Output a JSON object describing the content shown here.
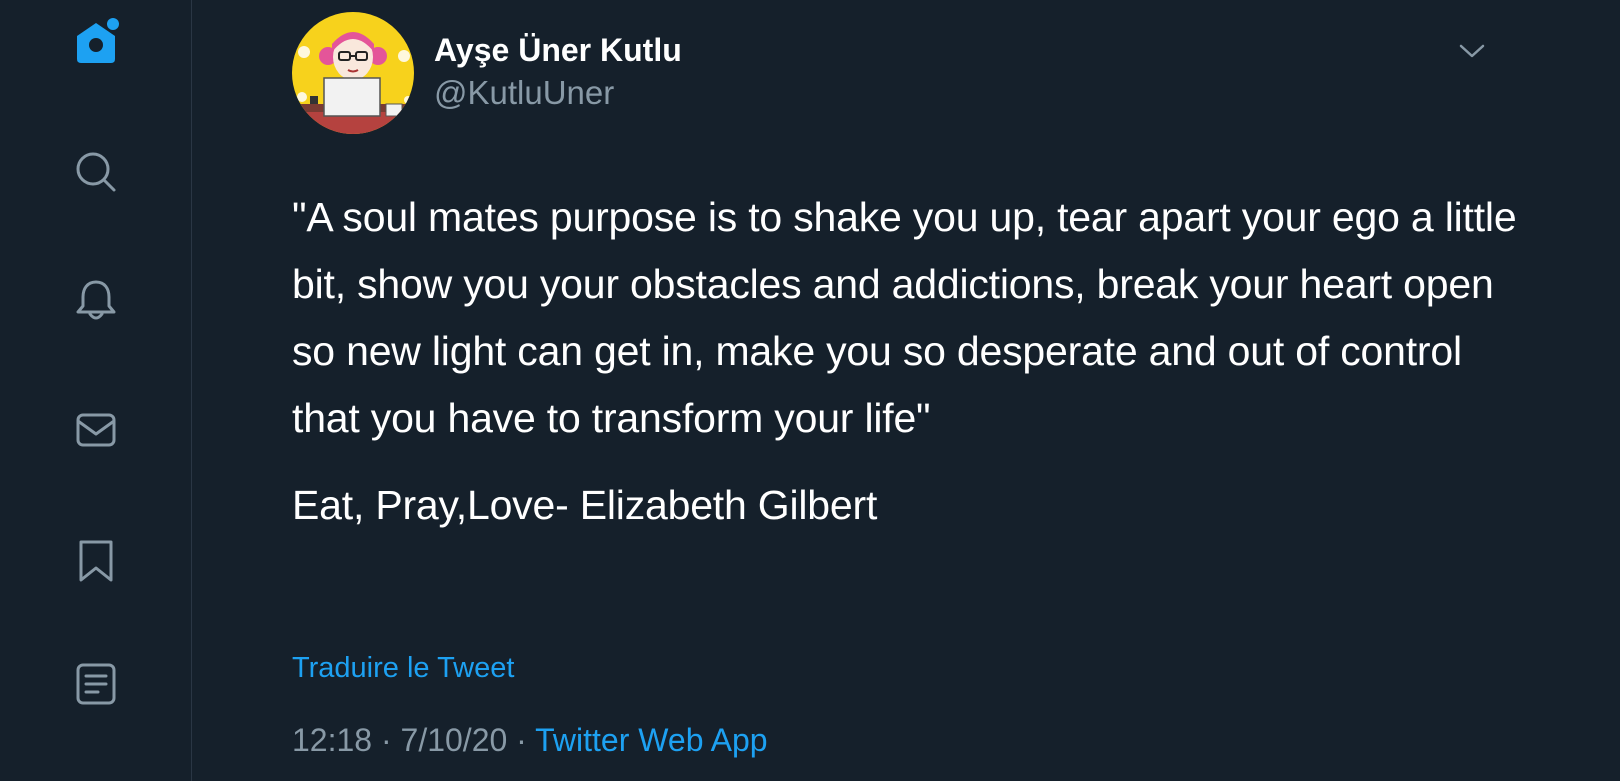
{
  "colors": {
    "background": "#15202b",
    "accent": "#1da1f2",
    "secondary_text": "#8899a6",
    "primary_text": "#ffffff"
  },
  "sidebar": {
    "items": [
      {
        "icon": "home-icon",
        "active": true
      },
      {
        "icon": "search-icon",
        "active": false
      },
      {
        "icon": "notifications-bell-icon",
        "active": false
      },
      {
        "icon": "messages-envelope-icon",
        "active": false
      },
      {
        "icon": "bookmark-icon",
        "active": false
      },
      {
        "icon": "lists-icon",
        "active": false
      }
    ]
  },
  "tweet": {
    "author": {
      "display_name": "Ayşe Üner Kutlu",
      "handle": "@KutluUner"
    },
    "body": "\"A soul mates purpose is to shake you up, tear apart your ego a little bit, show you your obstacles and addictions, break your heart open so new light can get in, make you so desperate and out of control that you have to transform your life\"",
    "attribution": "Eat, Pray,Love- Elizabeth Gilbert",
    "translate_label": "Traduire le Tweet",
    "time": "12:18",
    "date": "7/10/20",
    "separator": "·",
    "source": "Twitter Web App"
  }
}
